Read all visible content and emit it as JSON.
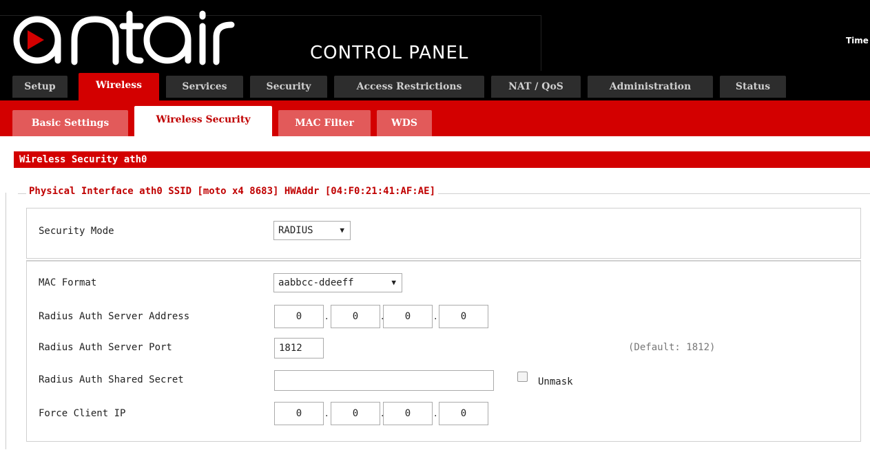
{
  "header": {
    "brand": "antaira",
    "control_panel": "CONTROL PANEL",
    "time_label": "Time"
  },
  "main_tabs": [
    {
      "label": "Setup",
      "active": false
    },
    {
      "label": "Wireless",
      "active": true
    },
    {
      "label": "Services",
      "active": false
    },
    {
      "label": "Security",
      "active": false
    },
    {
      "label": "Access Restrictions",
      "active": false
    },
    {
      "label": "NAT / QoS",
      "active": false
    },
    {
      "label": "Administration",
      "active": false
    },
    {
      "label": "Status",
      "active": false
    }
  ],
  "sub_tabs": [
    {
      "label": "Basic Settings",
      "active": false
    },
    {
      "label": "Wireless Security",
      "active": true
    },
    {
      "label": "MAC Filter",
      "active": false
    },
    {
      "label": "WDS",
      "active": false
    }
  ],
  "section": {
    "title": "Wireless Security ath0",
    "legend": "Physical Interface ath0 SSID [moto x4 8683] HWAddr [04:F0:21:41:AF:AE]"
  },
  "form": {
    "security_mode": {
      "label": "Security Mode",
      "value": "RADIUS"
    },
    "mac_format": {
      "label": "MAC Format",
      "value": "aabbcc-ddeeff"
    },
    "auth_server_address": {
      "label": "Radius Auth Server Address",
      "octets": [
        "0",
        "0",
        "0",
        "0"
      ]
    },
    "auth_server_port": {
      "label": "Radius Auth Server Port",
      "value": "1812",
      "hint": "(Default: 1812)"
    },
    "shared_secret": {
      "label": "Radius Auth Shared Secret",
      "value": "",
      "unmask_label": "Unmask"
    },
    "force_client_ip": {
      "label": "Force Client IP",
      "octets": [
        "0",
        "0",
        "0",
        "0"
      ]
    }
  },
  "colors": {
    "accent": "#d30000",
    "tab_dark": "#2d2d2d",
    "subtab_inactive": "#e25a5a"
  }
}
